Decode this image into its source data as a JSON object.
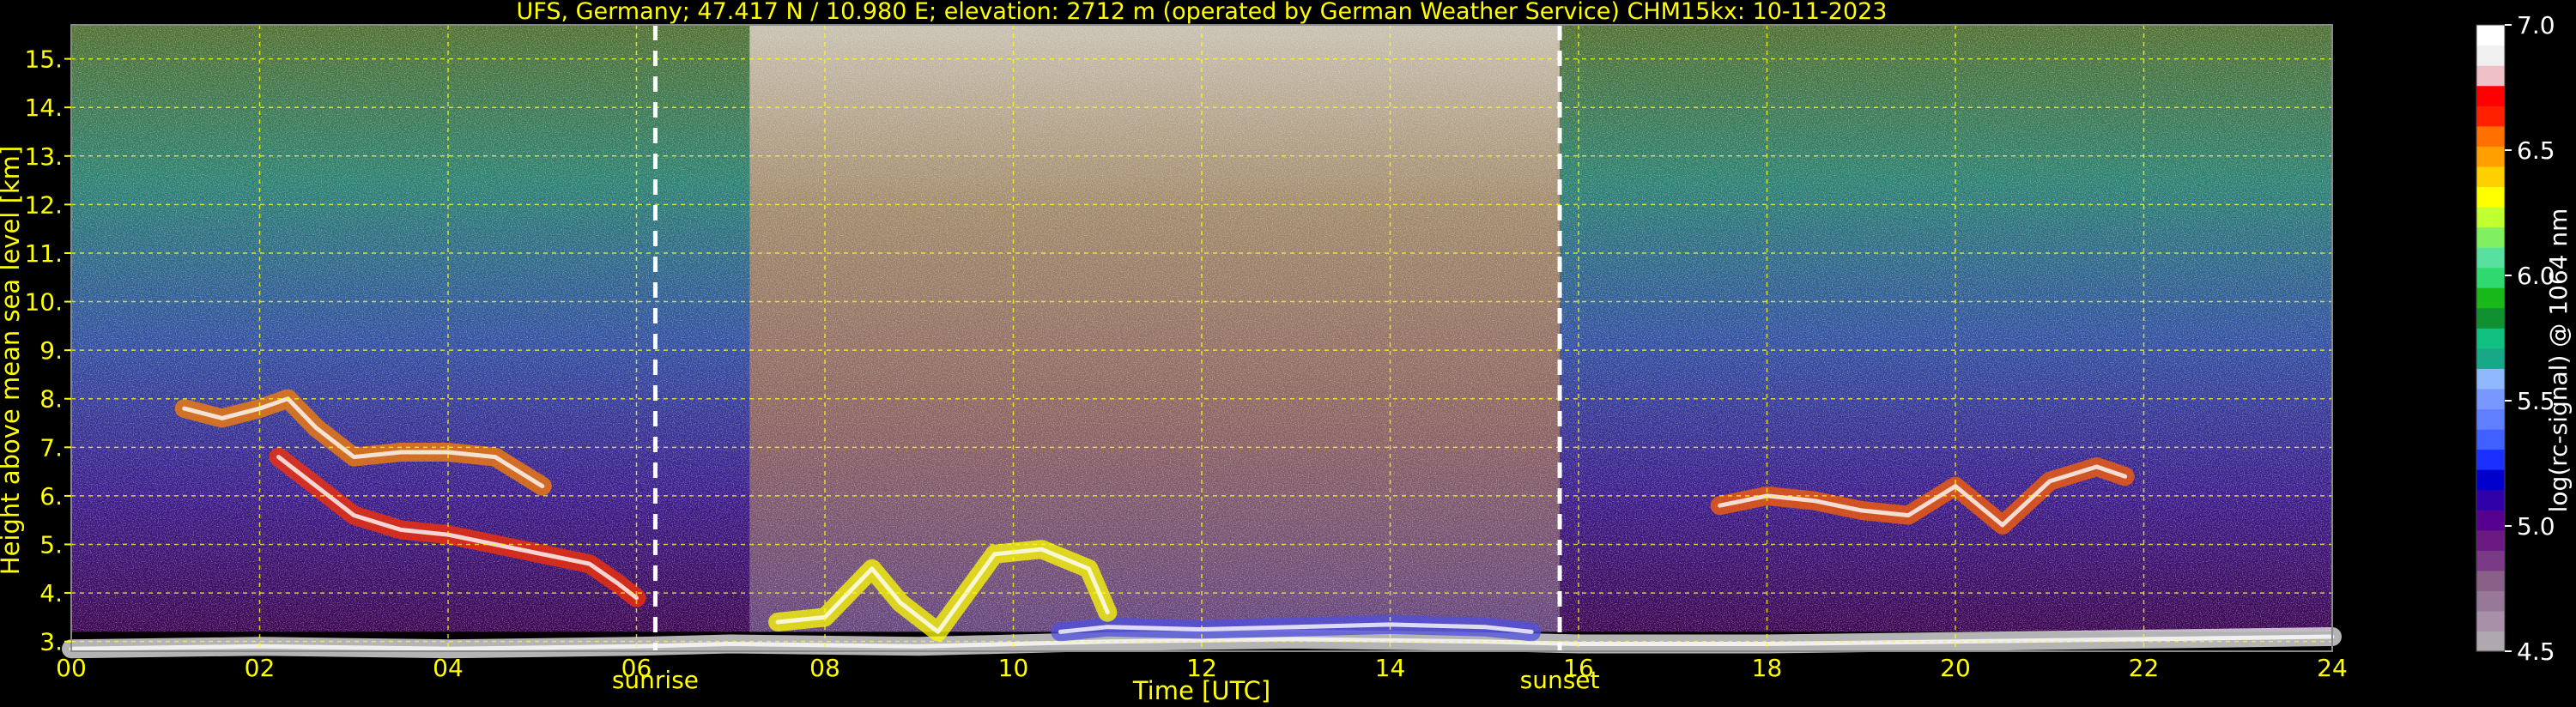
{
  "chart_data": {
    "type": "heatmap",
    "title": "UFS, Germany; 47.417 N / 10.980 E; elevation: 2712 m  (operated by German Weather Service)    CHM15kx: 10-11-2023",
    "xlabel": "Time [UTC]",
    "ylabel": "Height above mean sea level [km]",
    "xlim": [
      0,
      24
    ],
    "ylim": [
      2.8,
      15.7
    ],
    "x_ticks": [
      {
        "value": 0,
        "label": "00"
      },
      {
        "value": 2,
        "label": "02"
      },
      {
        "value": 4,
        "label": "04"
      },
      {
        "value": 6,
        "label": "06"
      },
      {
        "value": 8,
        "label": "08"
      },
      {
        "value": 10,
        "label": "10"
      },
      {
        "value": 12,
        "label": "12"
      },
      {
        "value": 14,
        "label": "14"
      },
      {
        "value": 16,
        "label": "16"
      },
      {
        "value": 18,
        "label": "18"
      },
      {
        "value": 20,
        "label": "20"
      },
      {
        "value": 22,
        "label": "22"
      },
      {
        "value": 24,
        "label": "24"
      }
    ],
    "y_ticks": [
      {
        "value": 3,
        "label": "3."
      },
      {
        "value": 4,
        "label": "4."
      },
      {
        "value": 5,
        "label": "5."
      },
      {
        "value": 6,
        "label": "6."
      },
      {
        "value": 7,
        "label": "7."
      },
      {
        "value": 8,
        "label": "8."
      },
      {
        "value": 9,
        "label": "9."
      },
      {
        "value": 10,
        "label": "10."
      },
      {
        "value": 11,
        "label": "11."
      },
      {
        "value": 12,
        "label": "12."
      },
      {
        "value": 13,
        "label": "13."
      },
      {
        "value": 14,
        "label": "14."
      },
      {
        "value": 15,
        "label": "15."
      }
    ],
    "grid": true,
    "grid_color": "#ffff00",
    "markers": [
      {
        "name": "sunrise",
        "x": 6.2,
        "label": "sunrise"
      },
      {
        "name": "sunset",
        "x": 15.8,
        "label": "sunset"
      }
    ],
    "colorbar": {
      "label": "log(rc-signal) @ 1064 nm",
      "range": [
        4.5,
        7.0
      ],
      "ticks": [
        {
          "value": 4.5,
          "label": "4.5"
        },
        {
          "value": 5.0,
          "label": "5.0"
        },
        {
          "value": 5.5,
          "label": "5.5"
        },
        {
          "value": 6.0,
          "label": "6.0"
        },
        {
          "value": 6.5,
          "label": "6.5"
        },
        {
          "value": 7.0,
          "label": "7.0"
        }
      ],
      "colors": [
        "#b0a8b0",
        "#a890a8",
        "#987898",
        "#886088",
        "#7a3a86",
        "#6a1a80",
        "#560090",
        "#3000a8",
        "#0000cc",
        "#1a30ff",
        "#4060ff",
        "#6080ff",
        "#7898ff",
        "#90b8ff",
        "#18a888",
        "#10c080",
        "#109030",
        "#18b818",
        "#30d870",
        "#58e0a0",
        "#80f060",
        "#c0ff30",
        "#ffff00",
        "#ffd000",
        "#ffa000",
        "#ff7000",
        "#ff2000",
        "#ff0000",
        "#f0c0c8",
        "#f0f0f0",
        "#ffffff"
      ]
    },
    "layers": [
      {
        "name": "ground-return",
        "color": "#f0f0f0",
        "points": [
          [
            0,
            2.85
          ],
          [
            2,
            2.9
          ],
          [
            4,
            2.85
          ],
          [
            6,
            2.9
          ],
          [
            7,
            2.95
          ],
          [
            9,
            2.9
          ],
          [
            11,
            3.0
          ],
          [
            13,
            3.05
          ],
          [
            15,
            3.0
          ],
          [
            16,
            2.95
          ],
          [
            18,
            2.95
          ],
          [
            20,
            3.0
          ],
          [
            22,
            3.05
          ],
          [
            24,
            3.1
          ]
        ]
      },
      {
        "name": "boundary-layer",
        "color": "#5050e0",
        "points": [
          [
            10.5,
            3.2
          ],
          [
            11,
            3.3
          ],
          [
            12,
            3.25
          ],
          [
            13,
            3.3
          ],
          [
            14,
            3.35
          ],
          [
            15,
            3.3
          ],
          [
            15.5,
            3.2
          ]
        ]
      },
      {
        "name": "cloud-night-high",
        "color": "#ff8000",
        "points": [
          [
            1.2,
            7.8
          ],
          [
            1.6,
            7.6
          ],
          [
            2.0,
            7.8
          ],
          [
            2.3,
            8.0
          ],
          [
            2.6,
            7.4
          ],
          [
            3.0,
            6.8
          ],
          [
            3.5,
            6.9
          ],
          [
            4.0,
            6.9
          ],
          [
            4.5,
            6.8
          ],
          [
            5.0,
            6.2
          ]
        ]
      },
      {
        "name": "cloud-night-low",
        "color": "#ff3000",
        "points": [
          [
            2.2,
            6.8
          ],
          [
            2.6,
            6.2
          ],
          [
            3.0,
            5.6
          ],
          [
            3.5,
            5.3
          ],
          [
            4.0,
            5.2
          ],
          [
            4.5,
            5.0
          ],
          [
            5.0,
            4.8
          ],
          [
            5.5,
            4.6
          ],
          [
            5.8,
            4.2
          ],
          [
            6.0,
            3.9
          ]
        ]
      },
      {
        "name": "cloud-morning",
        "color": "#ffff00",
        "points": [
          [
            7.5,
            3.4
          ],
          [
            8.0,
            3.5
          ],
          [
            8.5,
            4.5
          ],
          [
            8.8,
            3.8
          ],
          [
            9.2,
            3.2
          ],
          [
            9.8,
            4.8
          ],
          [
            10.3,
            4.9
          ],
          [
            10.8,
            4.5
          ],
          [
            11.0,
            3.6
          ]
        ]
      },
      {
        "name": "cloud-evening",
        "color": "#ff6000",
        "points": [
          [
            17.5,
            5.8
          ],
          [
            18.0,
            6.0
          ],
          [
            18.5,
            5.9
          ],
          [
            19.0,
            5.7
          ],
          [
            19.5,
            5.6
          ],
          [
            20.0,
            6.2
          ],
          [
            20.5,
            5.4
          ],
          [
            21.0,
            6.3
          ],
          [
            21.5,
            6.6
          ],
          [
            21.8,
            6.4
          ]
        ]
      }
    ]
  }
}
